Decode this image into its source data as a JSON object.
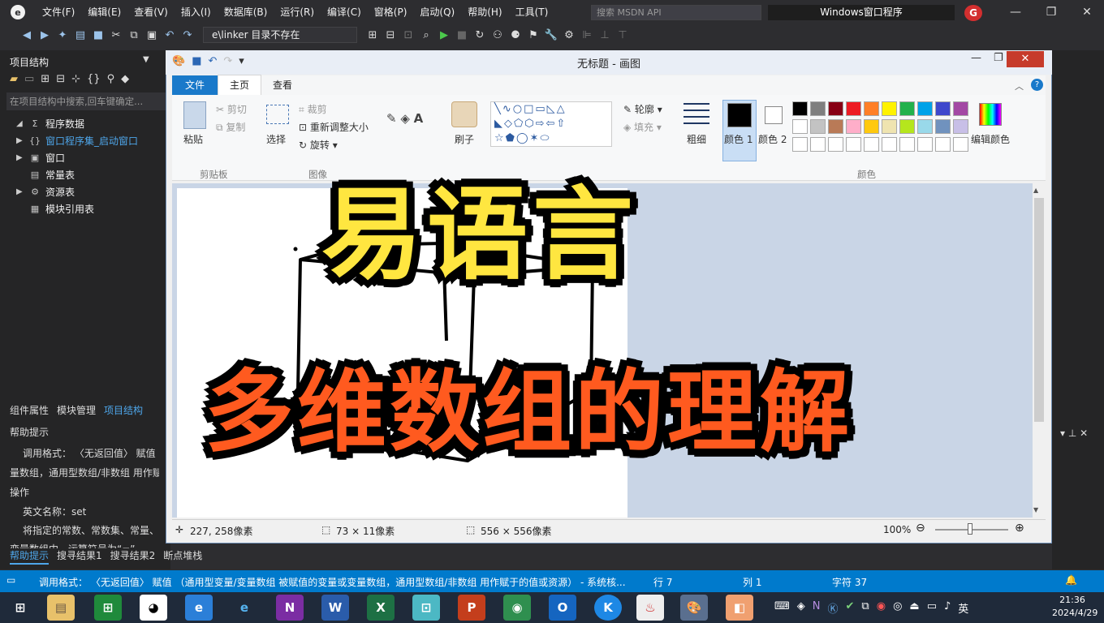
{
  "ide": {
    "menu": [
      "文件(F)",
      "编辑(E)",
      "查看(V)",
      "插入(I)",
      "数据库(B)",
      "运行(R)",
      "编译(C)",
      "窗格(P)",
      "启动(Q)",
      "帮助(H)",
      "工具(T)"
    ],
    "search_placeholder": "搜索 MSDN API",
    "window_title": "Windows窗口程序",
    "badge": "G",
    "path_combo": "e\\linker  目录不存在",
    "project_panel_title": "项目结构",
    "project_search": "在项目结构中搜索,回车键确定...",
    "tree": [
      {
        "label": "程序数据",
        "icon": "Σ",
        "toggle": "◢"
      },
      {
        "label": "窗口程序集_启动窗口",
        "icon": "{}",
        "toggle": "▶"
      },
      {
        "label": "窗口",
        "icon": "▣",
        "toggle": "▶"
      },
      {
        "label": "常量表",
        "icon": "▤",
        "toggle": ""
      },
      {
        "label": "资源表",
        "icon": "⚙",
        "toggle": "▶"
      },
      {
        "label": "模块引用表",
        "icon": "▦",
        "toggle": ""
      }
    ],
    "left_tabs": [
      "组件属性",
      "模块管理",
      "项目结构"
    ],
    "help_title": "帮助提示",
    "help_lines": [
      "调用格式： 〈无返回值〉 赋值 （",
      "量数组，通用型数组/非数组 用作赋",
      "操作",
      "英文名称：set",
      "将指定的常数、常数集、常量、资",
      "变量数组中，运算符号为“=”"
    ],
    "bottom_tabs": [
      "帮助提示",
      "搜寻结果1",
      "搜寻结果2",
      "断点堆栈"
    ],
    "statusbar": {
      "text": "调用格式： 〈无返回值〉 赋值 （通用型变量/变量数组 被赋值的变量或变量数组，通用型数组/非数组 用作赋于的值或资源） - 系统核...",
      "line": "行 7",
      "col": "列 1",
      "chars": "字符 37"
    }
  },
  "paint": {
    "title": "无标题 - 画图",
    "tab_file": "文件",
    "tabs": [
      "主页",
      "查看"
    ],
    "clipboard": {
      "paste": "粘贴",
      "cut": "剪切",
      "copy": "复制",
      "group": "剪贴板"
    },
    "image": {
      "select": "选择",
      "crop": "裁剪",
      "resize": "重新调整大小",
      "rotate": "旋转",
      "group": "图像"
    },
    "brushes": "刷子",
    "outline": "轮廓",
    "fill": "填充",
    "size": "粗细",
    "color1": "颜色 1",
    "color2": "颜色 2",
    "edit_colors": "编辑颜色",
    "colors_group": "颜色",
    "palette": [
      "#000000",
      "#7f7f7f",
      "#880015",
      "#ed1c24",
      "#ff7f27",
      "#fff200",
      "#22b14c",
      "#00a2e8",
      "#3f48cc",
      "#a349a4",
      "#ffffff",
      "#c3c3c3",
      "#b97a57",
      "#ffaec9",
      "#ffc90e",
      "#efe4b0",
      "#b5e61d",
      "#99d9ea",
      "#7092be",
      "#c8bfe7"
    ],
    "status": {
      "cursor": "227, 258像素",
      "selection": "73 × 11像素",
      "canvas": "556 × 556像素",
      "zoom": "100%"
    }
  },
  "overlay": {
    "line1": "易语言",
    "line2": "多维数组的理解"
  },
  "clock": {
    "time": "21:36",
    "date": "2024/4/29"
  },
  "tray_lang": "英"
}
